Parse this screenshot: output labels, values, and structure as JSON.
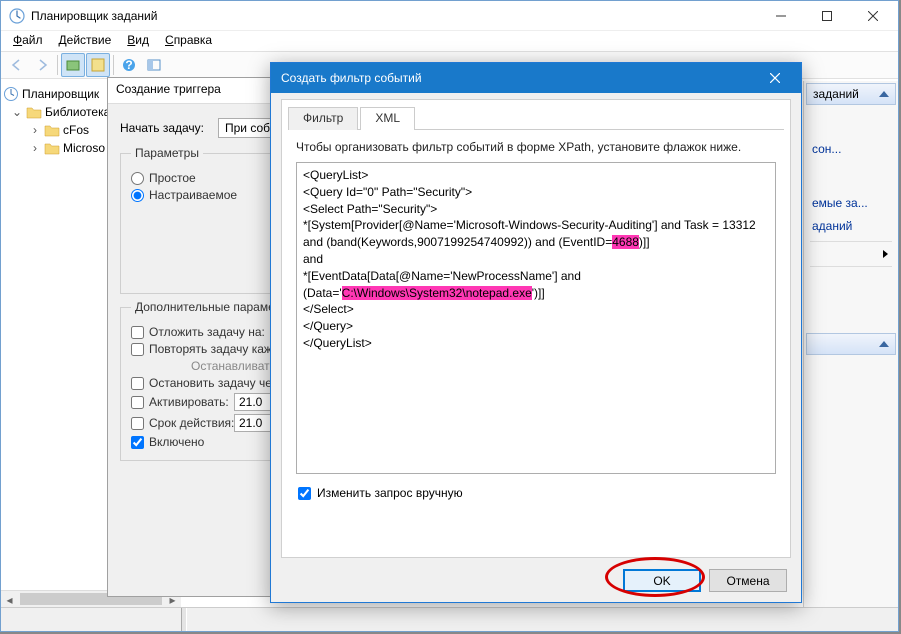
{
  "mainWindow": {
    "title": "Планировщик заданий",
    "menu": {
      "file": "Файл",
      "action": "Действие",
      "view": "Вид",
      "help": "Справка"
    }
  },
  "tree": {
    "root": "Планировщик",
    "library": "Библиотека",
    "items": [
      "cFos",
      "Microso"
    ]
  },
  "actions": {
    "header": "заданий",
    "lines": [
      "сон...",
      "емые за...",
      "аданий"
    ]
  },
  "trigger": {
    "title": "Создание триггера",
    "startTaskLabel": "Начать задачу:",
    "startTaskValue": "При соб",
    "paramsLegend": "Параметры",
    "radioSimple": "Простое",
    "radioCustom": "Настраиваемое",
    "extraLegend": "Дополнительные параметры",
    "cbPostpone": "Отложить задачу на:",
    "cbRepeat": "Повторять задачу каждые",
    "cbStopOn": "Останавливать",
    "cbStopAfter": "Остановить задачу через",
    "cbActivate": "Активировать:",
    "cbExpire": "Срок действия:",
    "cbEnabled": "Включено",
    "dateA": "21.0",
    "dateB": "21.0"
  },
  "filter": {
    "title": "Создать фильтр событий",
    "tabFilter": "Фильтр",
    "tabXML": "XML",
    "description": "Чтобы организовать фильтр событий в форме XPath, установите флажок ниже.",
    "xml_line1": "<QueryList>",
    "xml_line2": "<Query Id=\"0\" Path=\"Security\">",
    "xml_line3": "<Select Path=\"Security\">",
    "xml_line4a": "*[System[Provider[@Name='Microsoft-Windows-Security-Auditing'] and Task = 13312 and (band(Keywords,9007199254740992)) and (EventID=",
    "xml_hl1": "4688",
    "xml_line4b": ")]]",
    "xml_line5": "and",
    "xml_line6a": "*[EventData[Data[@Name='NewProcessName'] and (Data='",
    "xml_hl2": "C:\\Windows\\System32\\notepad.exe",
    "xml_line6b": "')]]",
    "xml_line7": "</Select>",
    "xml_line8": "</Query>",
    "xml_line9": "</QueryList>",
    "editManually": "Изменить запрос вручную",
    "okBtn": "OK",
    "cancelBtn": "Отмена"
  }
}
